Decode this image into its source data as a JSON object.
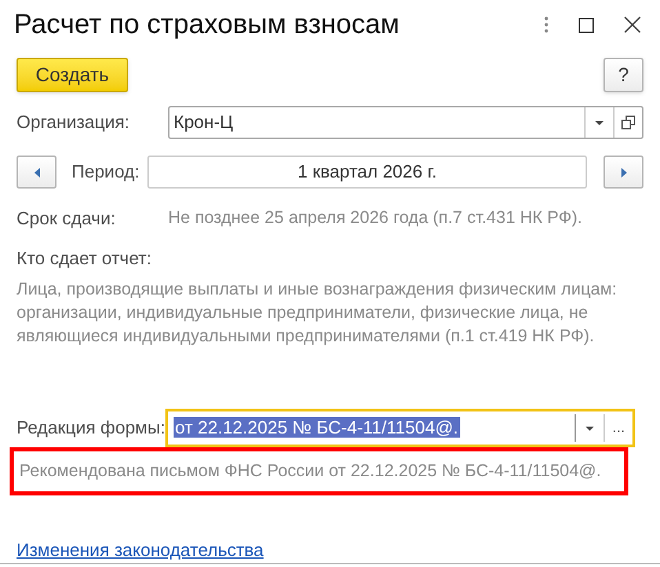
{
  "window": {
    "title": "Расчет по страховым взносам"
  },
  "toolbar": {
    "create_button": "Создать",
    "help_button": "?"
  },
  "organization": {
    "label": "Организация:",
    "value": "Крон-Ц"
  },
  "period": {
    "label": "Период:",
    "value": "1 квартал 2026 г."
  },
  "deadline": {
    "label": "Срок сдачи:",
    "value": "Не позднее 25 апреля 2026 года (п.7 ст.431 НК РФ)."
  },
  "who_reports": {
    "label": "Кто сдает отчет:",
    "value": "Лица, производящие выплаты и иные вознаграждения физическим лицам: организации, индивидуальные предприниматели, физические лица, не являющиеся индивидуальными предпринимателями (п.1 ст.419 НК РФ)."
  },
  "form_edition": {
    "label": "Редакция формы:",
    "value": "от 22.12.2025 № БС-4-11/11504@.",
    "focused": true,
    "value_selected": true,
    "more_button": "..."
  },
  "recommendation": {
    "text": "Рекомендована письмом ФНС России от 22.12.2025 № БС-4-11/11504@.",
    "highlighted": true
  },
  "legislation_link": "Изменения законодательства"
}
